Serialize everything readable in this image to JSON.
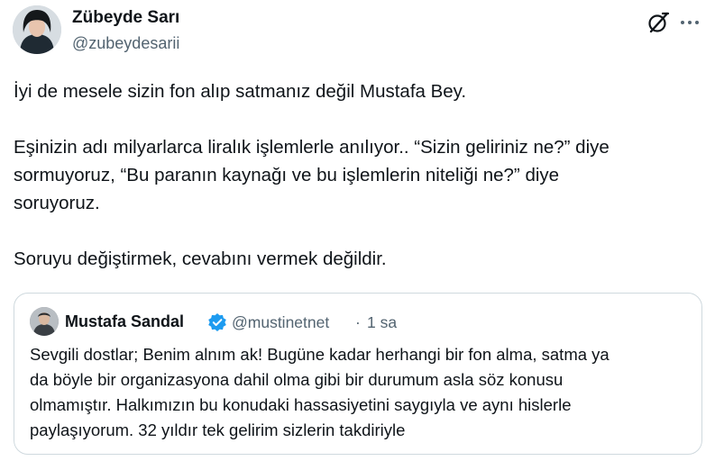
{
  "author": {
    "name": "Zübeyde Sarı",
    "handle": "@zubeydesarii"
  },
  "icons": {
    "grok": "grok-icon",
    "more": "more-options-icon",
    "verified": "verified-badge-icon"
  },
  "colors": {
    "text": "#0f1419",
    "secondary": "#536471",
    "border": "#cfd9de",
    "verified": "#1d9bf0"
  },
  "tweet": {
    "paragraphs": [
      [
        "İyi de mesele sizin fon alıp satmanız değil Mustafa Bey."
      ],
      [
        "Eşinizin adı milyarlarca liralık işlemlerle anılıyor.. “Sizin geliriniz ne?” diye",
        "sormuyoruz, “Bu paranın kaynağı ve bu işlemlerin niteliği ne?” diye",
        "soruyoruz."
      ],
      [
        "Soruyu değiştirmek, cevabını vermek değildir."
      ]
    ]
  },
  "quoted": {
    "name": "Mustafa Sandal",
    "handle": "@mustinetnet",
    "separator": "·",
    "time": "1 sa",
    "lines": [
      "Sevgili dostlar; Benim alnım ak! Bugüne kadar herhangi bir fon alma, satma ya",
      "da böyle bir organizasyona dahil olma gibi bir durumum asla söz konusu",
      "olmamıştır. Halkımızın bu konudaki hassasiyetini saygıyla ve aynı hislerle",
      "paylaşıyorum. 32 yıldır tek gelirim sizlerin takdiriyle"
    ]
  }
}
